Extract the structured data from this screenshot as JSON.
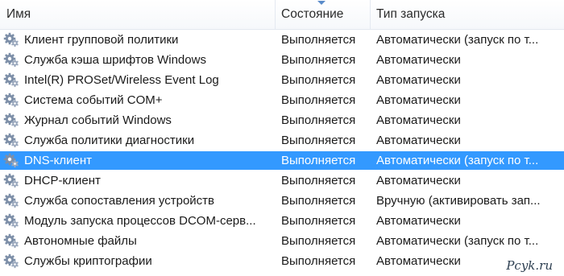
{
  "columns": {
    "name": "Имя",
    "status": "Состояние",
    "startup": "Тип запуска"
  },
  "rows": [
    {
      "name": "Клиент групповой политики",
      "status": "Выполняется",
      "startup": "Автоматически (запуск по т..."
    },
    {
      "name": "Служба кэша шрифтов Windows",
      "status": "Выполняется",
      "startup": "Автоматически"
    },
    {
      "name": "Intel(R) PROSet/Wireless Event Log",
      "status": "Выполняется",
      "startup": "Автоматически"
    },
    {
      "name": "Система событий COM+",
      "status": "Выполняется",
      "startup": "Автоматически"
    },
    {
      "name": "Журнал событий Windows",
      "status": "Выполняется",
      "startup": "Автоматически"
    },
    {
      "name": "Служба политики диагностики",
      "status": "Выполняется",
      "startup": "Автоматически"
    },
    {
      "name": "DNS-клиент",
      "status": "Выполняется",
      "startup": "Автоматически (запуск по т...",
      "selected": true
    },
    {
      "name": "DHCP-клиент",
      "status": "Выполняется",
      "startup": "Автоматически"
    },
    {
      "name": "Служба сопоставления устройств",
      "status": "Выполняется",
      "startup": "Вручную (активировать зап..."
    },
    {
      "name": "Модуль запуска процессов DCOM-серв...",
      "status": "Выполняется",
      "startup": "Автоматически"
    },
    {
      "name": "Автономные файлы",
      "status": "Выполняется",
      "startup": "Автоматически (запуск по т..."
    },
    {
      "name": "Службы криптографии",
      "status": "Выполняется",
      "startup": "Автоматически"
    }
  ],
  "sort_column": "status",
  "watermark": {
    "text": "Pcyk.ru"
  },
  "colors": {
    "selection": "#3399ff",
    "sort_arrow": "#5a8bc9",
    "gear": "#7d8fa8"
  },
  "row_icon": "service-gear-icon"
}
